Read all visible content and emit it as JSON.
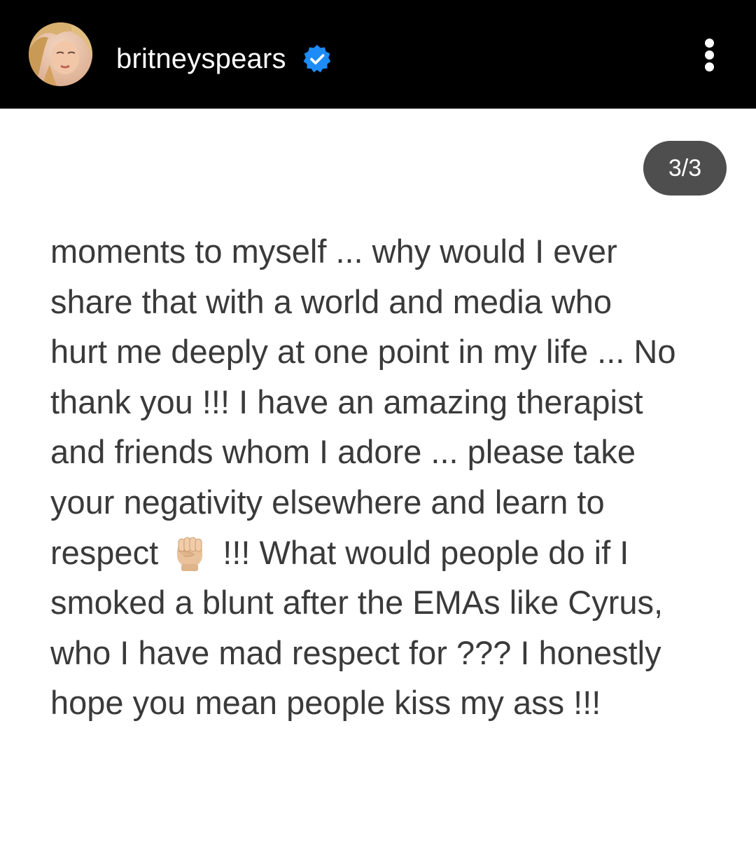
{
  "header": {
    "username": "britneyspears",
    "verified": true,
    "more_icon": "more-vertical-icon"
  },
  "story": {
    "page_indicator": "3/3",
    "lines": [
      "moments to myself ... why would I ever",
      "share that with a world and media who",
      "hurt me deeply at one point in my life ... No",
      "thank you !!! I have an amazing therapist",
      "and friends whom I adore ... please take",
      "your negativity elsewhere and learn to"
    ],
    "line7_before": "respect",
    "emoji_icon": "raised-fist-emoji-icon",
    "line7_after": "!!! What would people do if I",
    "lines_after": [
      "smoked a blunt after the EMAs like Cyrus,",
      "who I have mad respect for ??? I honestly",
      "hope you mean people kiss my ass !!!"
    ]
  },
  "colors": {
    "header_bg": "#000000",
    "verified_blue": "#1d8cf8",
    "badge_bg": "#4e4e4e",
    "text": "#3a3a3a"
  }
}
